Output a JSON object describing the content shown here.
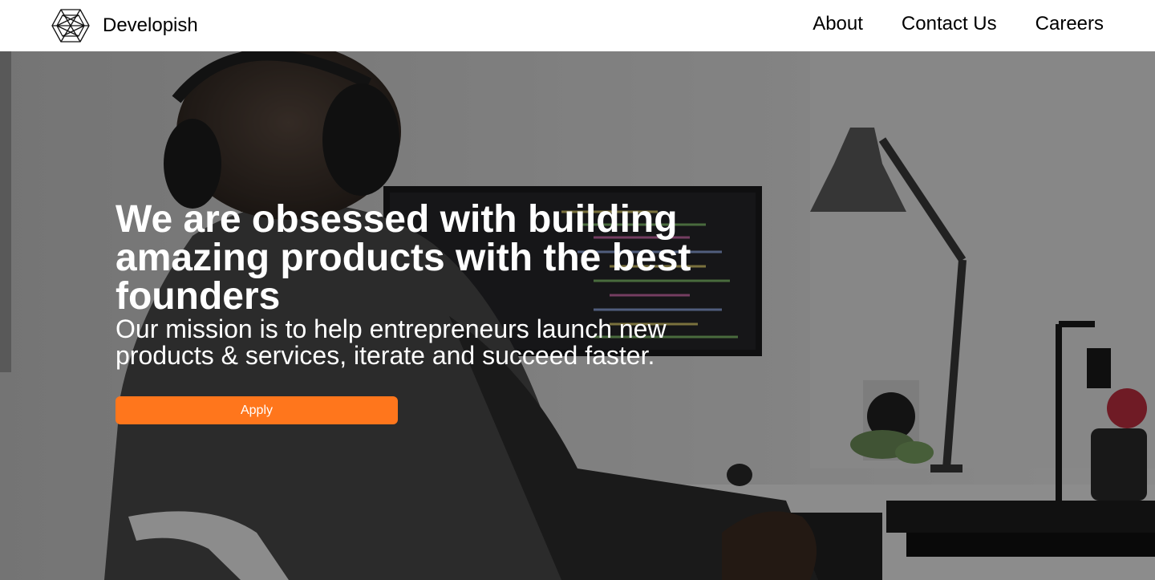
{
  "header": {
    "brand_name": "Developish",
    "logo_icon": "hexagon-wireframe-icon",
    "nav": {
      "about": "About",
      "contact": "Contact Us",
      "careers": "Careers"
    }
  },
  "hero": {
    "title": "We are obsessed with building amazing products with the best founders",
    "subtitle": "Our mission is to help entrepreneurs launch new products & services, iterate and succeed faster.",
    "apply_label": "Apply",
    "background_image": "person-with-headphones-coding-at-desk"
  },
  "colors": {
    "accent": "#ff761c",
    "header_bg": "#ffffff",
    "text_dark": "#000000",
    "text_light": "#ffffff"
  }
}
